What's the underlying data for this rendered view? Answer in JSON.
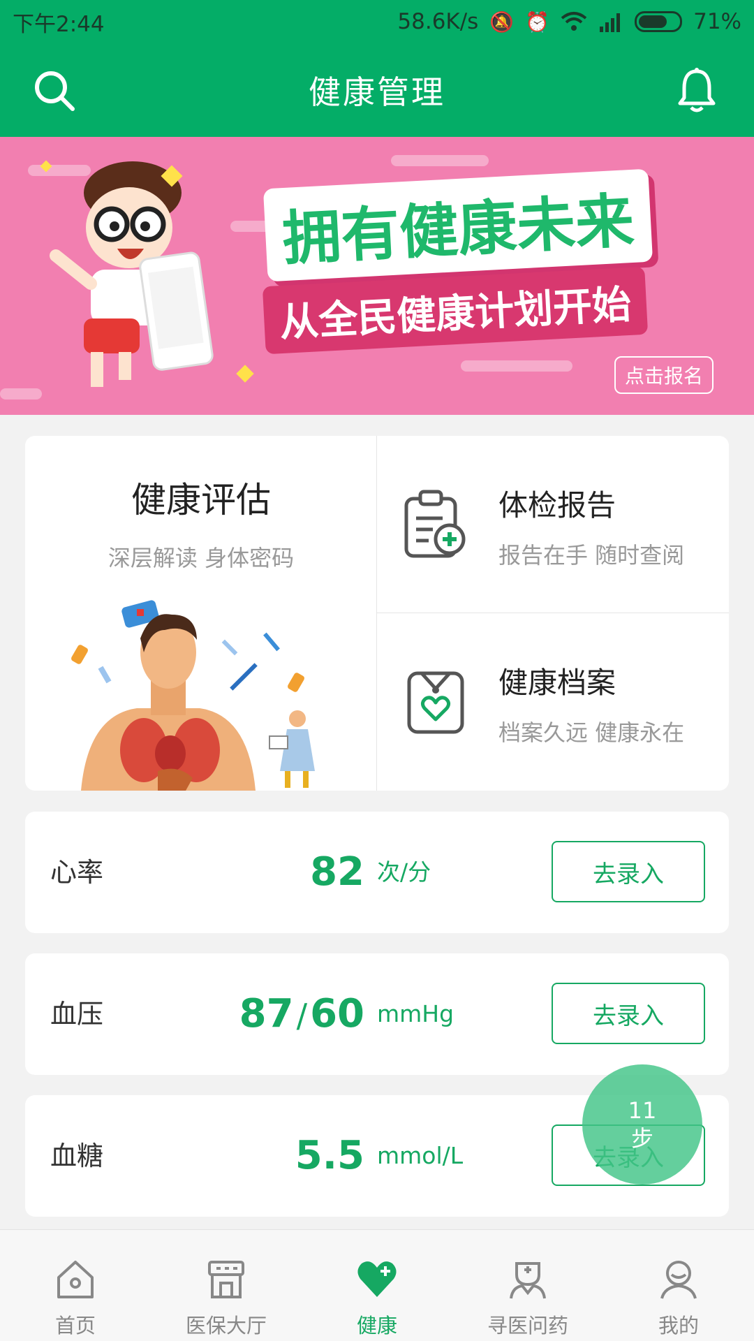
{
  "status_bar": {
    "time": "下午2:44",
    "network_speed": "58.6K/s",
    "battery_percent": "71%",
    "battery_level": 0.71
  },
  "header": {
    "title": "健康管理",
    "search_icon": "search-icon",
    "bell_icon": "bell-icon"
  },
  "banner": {
    "title": "拥有健康未来",
    "subtitle": "从全民健康计划开始",
    "button_label": "点击报名"
  },
  "features": {
    "assessment": {
      "title": "健康评估",
      "subtitle": "深层解读 身体密码"
    },
    "report": {
      "title": "体检报告",
      "subtitle": "报告在手 随时查阅",
      "icon": "clipboard-plus-icon"
    },
    "archive": {
      "title": "健康档案",
      "subtitle": "档案久远 健康永在",
      "icon": "heart-badge-icon"
    }
  },
  "metrics": [
    {
      "label": "心率",
      "value": "82",
      "unit": "次/分",
      "button": "去录入"
    },
    {
      "label": "血压",
      "value_high": "87",
      "value_sep": "/",
      "value_low": "60",
      "unit": "mmHg",
      "button": "去录入"
    },
    {
      "label": "血糖",
      "value": "5.5",
      "unit": "mmol/L",
      "button": "去录入"
    }
  ],
  "step_bubble": {
    "count": "11",
    "unit": "步"
  },
  "bottom_nav": [
    {
      "label": "首页",
      "icon": "home-icon",
      "active": false
    },
    {
      "label": "医保大厅",
      "icon": "hall-icon",
      "active": false
    },
    {
      "label": "健康",
      "icon": "heart-plus-icon",
      "active": true
    },
    {
      "label": "寻医问药",
      "icon": "doctor-icon",
      "active": false
    },
    {
      "label": "我的",
      "icon": "user-icon",
      "active": false
    }
  ],
  "colors": {
    "primary": "#04ad67",
    "accent_text": "#16a862",
    "banner_bg": "#f27fb0"
  }
}
